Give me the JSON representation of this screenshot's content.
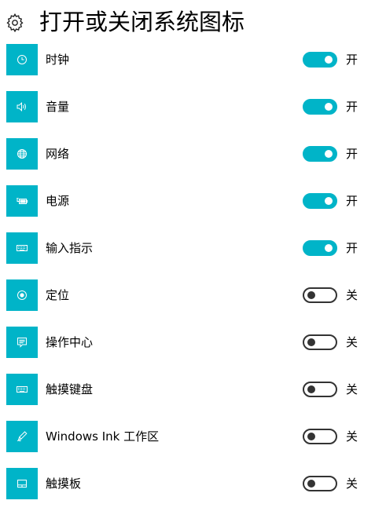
{
  "page": {
    "title": "打开或关闭系统图标",
    "accent_color": "#00b4c8"
  },
  "header": {
    "icon": "gear-icon"
  },
  "items": [
    {
      "label": "时钟",
      "icon": "clock-icon",
      "state_label": "开",
      "on": true
    },
    {
      "label": "音量",
      "icon": "volume-icon",
      "state_label": "开",
      "on": true
    },
    {
      "label": "网络",
      "icon": "globe-icon",
      "state_label": "开",
      "on": true
    },
    {
      "label": "电源",
      "icon": "battery-icon",
      "state_label": "开",
      "on": true
    },
    {
      "label": "输入指示",
      "icon": "keyboard-icon",
      "state_label": "开",
      "on": true
    },
    {
      "label": "定位",
      "icon": "location-icon",
      "state_label": "关",
      "on": false
    },
    {
      "label": "操作中心",
      "icon": "action-center-icon",
      "state_label": "关",
      "on": false
    },
    {
      "label": "触摸键盘",
      "icon": "keyboard-icon",
      "state_label": "关",
      "on": false
    },
    {
      "label": "Windows Ink 工作区",
      "icon": "pen-icon",
      "state_label": "关",
      "on": false
    },
    {
      "label": "触摸板",
      "icon": "touchpad-icon",
      "state_label": "关",
      "on": false
    }
  ]
}
